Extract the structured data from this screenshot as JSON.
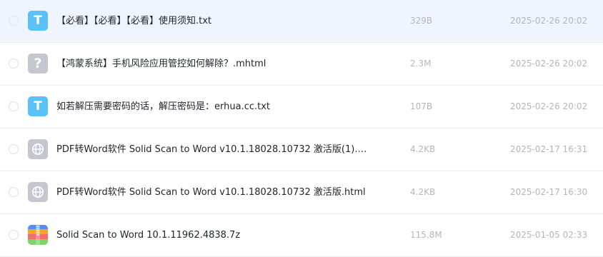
{
  "files": [
    {
      "icon": "txt-file-icon",
      "icon_glyph": "T",
      "name": "【必看】【必看】【必看】使用须知.txt",
      "size": "329B",
      "date": "2025-02-26 20:02",
      "selected": true
    },
    {
      "icon": "unknown-file-icon",
      "icon_glyph": "?",
      "name": "【鸿蒙系统】手机风险应用管控如何解除？.mhtml",
      "size": "2.3M",
      "date": "2025-02-26 20:02",
      "selected": false
    },
    {
      "icon": "txt-file-icon",
      "icon_glyph": "T",
      "name": "如若解压需要密码的话，解压密码是：erhua.cc.txt",
      "size": "107B",
      "date": "2025-02-26 20:02",
      "selected": false
    },
    {
      "icon": "html-file-icon",
      "icon_glyph": "",
      "name": "PDF转Word软件 Solid Scan to Word v10.1.18028.10732 激活版(1).ht…",
      "size": "4.2KB",
      "date": "2025-02-17 16:31",
      "selected": false
    },
    {
      "icon": "html-file-icon",
      "icon_glyph": "",
      "name": "PDF转Word软件 Solid Scan to Word v10.1.18028.10732 激活版.html",
      "size": "4.2KB",
      "date": "2025-02-17 16:30",
      "selected": false
    },
    {
      "icon": "archive-file-icon",
      "icon_glyph": "",
      "name": "Solid Scan to Word 10.1.11962.4838.7z",
      "size": "115.8M",
      "date": "2025-01-05 02:33",
      "selected": false
    }
  ],
  "colors": {
    "txt_icon": "#5bc2f7",
    "neutral_icon": "#c4c7d0",
    "selected_row": "#f0f4ff",
    "archive_stripes": [
      "#4f8ff7",
      "#f5a623",
      "#f56c6c",
      "#7ed36b"
    ]
  }
}
